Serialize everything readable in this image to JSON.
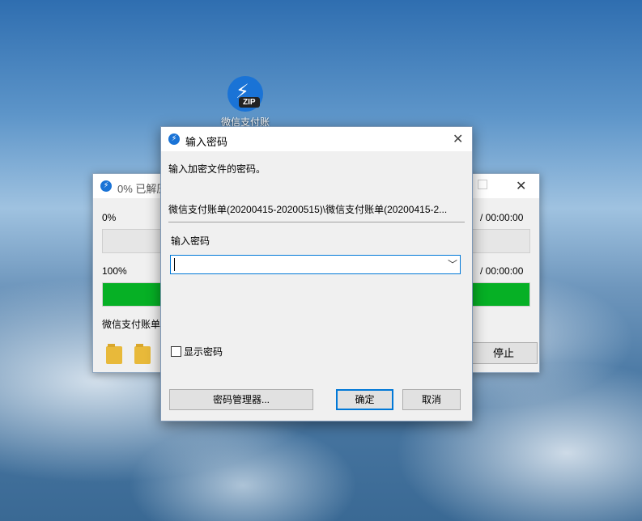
{
  "desktop": {
    "zip_tag": "ZIP",
    "icon_label": "微信支付账"
  },
  "progress_window": {
    "title": "0% 已解压",
    "row1": {
      "percent": "0%",
      "time": "/ 00:00:00",
      "progress": 0
    },
    "row2": {
      "percent": "100%",
      "time": "/ 00:00:00",
      "progress": 1
    },
    "current_file": "微信支付账单",
    "stop_label": "停止",
    "accent_color": "#06b025"
  },
  "password_dialog": {
    "title": "输入密码",
    "prompt": "输入加密文件的密码。",
    "file_path": "微信支付账单(20200415-20200515)\\微信支付账单(20200415-2...",
    "password_label": "输入密码",
    "password_value": "",
    "show_password_label": "显示密码",
    "show_password_checked": false,
    "buttons": {
      "manager": "密码管理器...",
      "ok": "确定",
      "cancel": "取消"
    },
    "accent_color": "#0078d7"
  },
  "icons": [
    "bandizip-logo-icon",
    "close-icon",
    "maximize-icon",
    "chevron-down-icon",
    "folder-icon",
    "zip-file-icon"
  ]
}
